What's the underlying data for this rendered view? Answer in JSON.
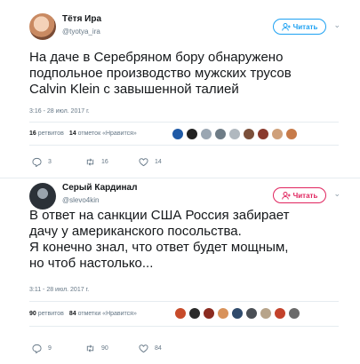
{
  "tweets": [
    {
      "name": "Тётя Ира",
      "handle": "@tyotya_ira",
      "follow_label": "Читать",
      "text": "На даче в Серебряном бору обнаружено\nподпольное производство мужских трусов\nCalvin Klein с завышенной талией",
      "time": "3:16 - 28 июл. 2017 г.",
      "retweets_count": "16",
      "retweets_label": "ретвитов",
      "likes_count": "14",
      "likes_label": "отметок «Нравится»",
      "actions": {
        "replies": "3",
        "retweets": "16",
        "likes": "14"
      },
      "face_colors": [
        "#1f5aa6",
        "#222222",
        "#9aa6b2",
        "#6e7c86",
        "#b0b8bf",
        "#7b4f3a",
        "#8a3a2d",
        "#cfa07a",
        "#c77b4a"
      ]
    },
    {
      "name": "Серый Кардинал",
      "handle": "@slevo4kin",
      "follow_label": "Читать",
      "text": "В ответ на санкции США Россия забирает\nдачу у американского посольства.\nЯ конечно знал, что ответ будет мощным,\nно чтоб настолько...",
      "time": "3:11 - 28 июл. 2017 г.",
      "retweets_count": "90",
      "retweets_label": "ретвитов",
      "likes_count": "84",
      "likes_label": "отметки «Нравится»",
      "actions": {
        "replies": "9",
        "retweets": "90",
        "likes": "84"
      },
      "face_colors": [
        "#c74b2a",
        "#2a2a2a",
        "#8b2b20",
        "#d8925a",
        "#2f4a6b",
        "#4a4f55",
        "#b7a48a",
        "#c3422b",
        "#6a6a6a"
      ]
    }
  ],
  "colors": {
    "accent": "#1da1f2",
    "follow_2": "#e0245e",
    "muted": "#657786",
    "separator": "#e6ecf0"
  }
}
